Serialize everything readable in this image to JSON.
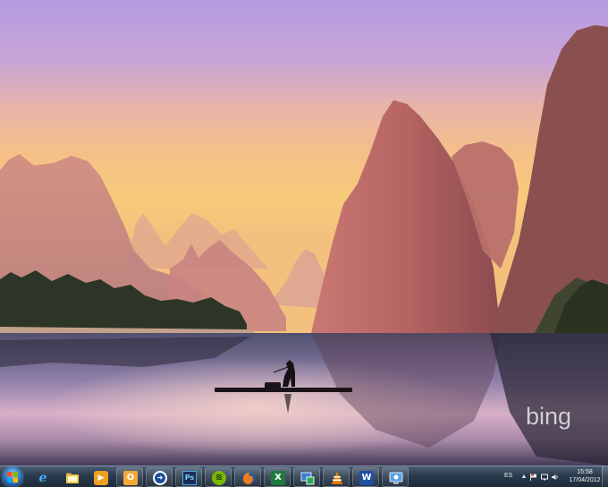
{
  "desktop": {
    "watermark_text": "bing"
  },
  "taskbar": {
    "buttons": [
      {
        "name": "internet-explorer",
        "glyph": "e",
        "pinned": true
      },
      {
        "name": "file-explorer",
        "glyph": "",
        "pinned": true
      },
      {
        "name": "media-player",
        "glyph": "▶",
        "pinned": true
      },
      {
        "name": "outlook",
        "glyph": "O",
        "pinned": false
      },
      {
        "name": "app-circle",
        "glyph": "➜",
        "pinned": false
      },
      {
        "name": "photoshop",
        "glyph": "Ps",
        "pinned": false
      },
      {
        "name": "spotify",
        "glyph": "≋",
        "pinned": false
      },
      {
        "name": "firefox",
        "glyph": "",
        "pinned": false
      },
      {
        "name": "excel",
        "glyph": "X",
        "pinned": false
      },
      {
        "name": "app-tools",
        "glyph": "",
        "pinned": false
      },
      {
        "name": "vlc",
        "glyph": "",
        "pinned": false
      },
      {
        "name": "word",
        "glyph": "W",
        "pinned": false
      },
      {
        "name": "app-remote",
        "glyph": "",
        "pinned": false
      }
    ],
    "tray": {
      "language": "ES",
      "time": "15:58",
      "date": "17/04/2012"
    }
  },
  "colors": {
    "taskbar_top": "#4a5d72",
    "taskbar_bottom": "#1e2b3a",
    "accent_blue": "#3b8ad6"
  }
}
